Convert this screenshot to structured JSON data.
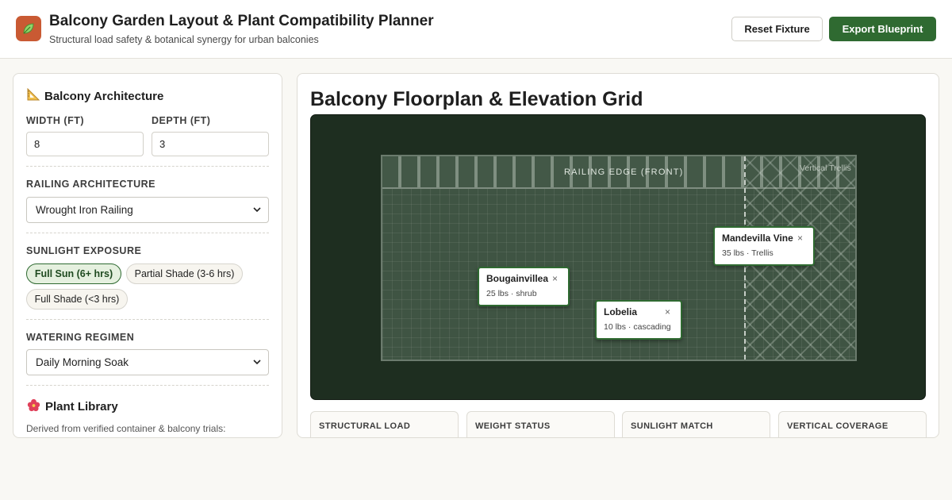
{
  "header": {
    "title": "Balcony Garden Layout & Plant Compatibility Planner",
    "subtitle": "Structural load safety & botanical synergy for urban balconies",
    "reset_label": "Reset Fixture",
    "export_label": "Export Blueprint"
  },
  "sidebar": {
    "architecture_title": "Balcony Architecture",
    "width_label": "WIDTH (FT)",
    "width_value": "8",
    "depth_label": "DEPTH (FT)",
    "depth_value": "3",
    "railing_label": "RAILING ARCHITECTURE",
    "railing_value": "Wrought Iron Railing",
    "sunlight_label": "SUNLIGHT EXPOSURE",
    "sunlight_options": [
      "Full Sun (6+ hrs)",
      "Partial Shade (3-6 hrs)",
      "Full Shade (<3 hrs)"
    ],
    "sunlight_selected": "Full Sun (6+ hrs)",
    "watering_label": "WATERING REGIMEN",
    "watering_value": "Daily Morning Soak",
    "library_title": "Plant Library",
    "library_note": "Derived from verified container & balcony trials:"
  },
  "floorplan": {
    "title": "Balcony Floorplan & Elevation Grid",
    "railing_edge_label": "RAILING EDGE (FRONT)",
    "trellis_label": "Vertical Trellis",
    "plants": [
      {
        "name": "Bougainvillea",
        "meta": "25 lbs · shrub"
      },
      {
        "name": "Lobelia",
        "meta": "10 lbs · cascading"
      },
      {
        "name": "Mandevilla Vine",
        "meta": "35 lbs · Trellis"
      }
    ]
  },
  "stats": [
    {
      "label": "STRUCTURAL LOAD"
    },
    {
      "label": "WEIGHT STATUS"
    },
    {
      "label": "SUNLIGHT MATCH"
    },
    {
      "label": "VERTICAL COVERAGE"
    }
  ],
  "colors": {
    "brand_green": "#2f6a31",
    "logo_orange": "#c95a33",
    "canvas_dark": "#1e2e20"
  },
  "icons": {
    "logo": "leaf-icon",
    "architecture": "triangular-ruler-icon",
    "library": "hibiscus-icon",
    "close": "close-icon",
    "dropdown": "chevron-down-icon"
  }
}
